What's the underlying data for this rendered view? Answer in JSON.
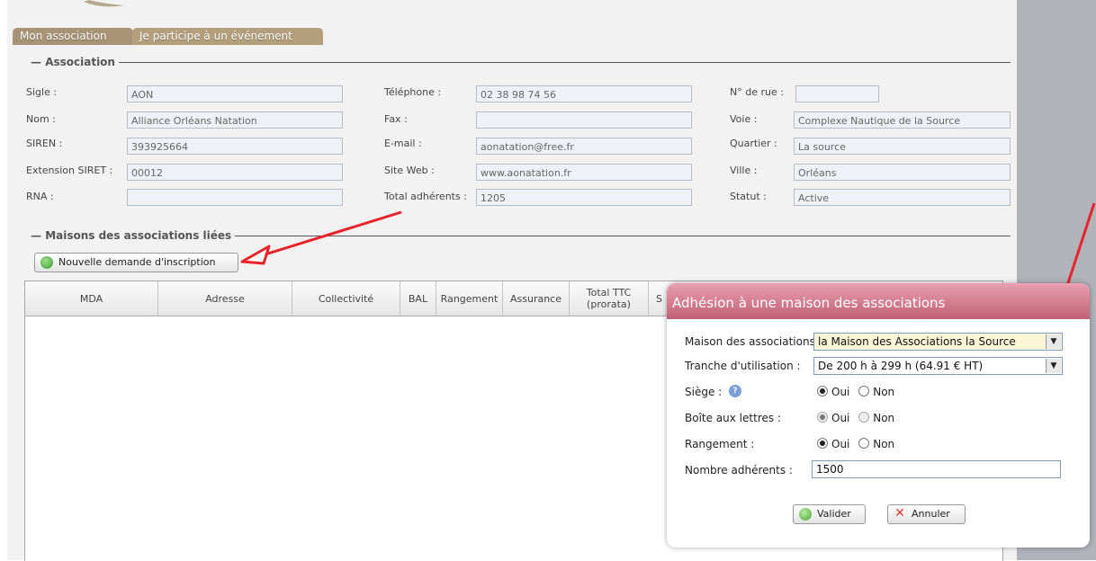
{
  "tabs": [
    {
      "label": "Mon association",
      "active": true
    },
    {
      "label": "Je participe à un événement",
      "active": false
    }
  ],
  "association": {
    "legend": "Association",
    "fields": [
      {
        "label": "Sigle :",
        "value": "AON"
      },
      {
        "label": "Nom :",
        "value": "Alliance Orléans Natation"
      },
      {
        "label": "SIREN :",
        "value": "393925664"
      },
      {
        "label": "Extension SIRET :",
        "value": "00012"
      },
      {
        "label": "RNA :",
        "value": ""
      },
      {
        "label": "Téléphone :",
        "value": "02 38 98 74 56"
      },
      {
        "label": "Fax :",
        "value": ""
      },
      {
        "label": "E-mail :",
        "value": "aonatation@free.fr"
      },
      {
        "label": "Site Web :",
        "value": "www.aonatation.fr"
      },
      {
        "label": "Total adhérents :",
        "value": "1205"
      },
      {
        "label": "N° de rue :",
        "value": ""
      },
      {
        "label": "Voie :",
        "value": "Complexe Nautique de la Source"
      },
      {
        "label": "Quartier :",
        "value": "La source"
      },
      {
        "label": "Ville :",
        "value": "Orléans"
      },
      {
        "label": "Statut :",
        "value": "Active"
      }
    ]
  },
  "maisons": {
    "legend": "Maisons des associations liées",
    "new_button": "Nouvelle demande d'inscription",
    "columns": [
      "MDA",
      "Adresse",
      "Collectivité",
      "BAL",
      "Rangement",
      "Assurance",
      "Total TTC (prorata)",
      "S"
    ]
  },
  "modal": {
    "title": "Adhésion à une maison des associations",
    "maison_label": "Maison des associations :",
    "maison_value": "la Maison des Associations la Source",
    "tranche_label": "Tranche d'utilisation :",
    "tranche_value": "De 200 h à 299 h (64.91 € HT)",
    "siege_label": "Siège :",
    "bal_label": "Boîte aux lettres :",
    "rangement_label": "Rangement :",
    "oui": "Oui",
    "non": "Non",
    "adherents_label": "Nombre adhérents :",
    "adherents_value": "1500",
    "valider": "Valider",
    "annuler": "Annuler"
  },
  "colors": {
    "tab_active": "#a89474",
    "modal_title": "#c16075",
    "annotation_arrow": "#e8232a"
  }
}
